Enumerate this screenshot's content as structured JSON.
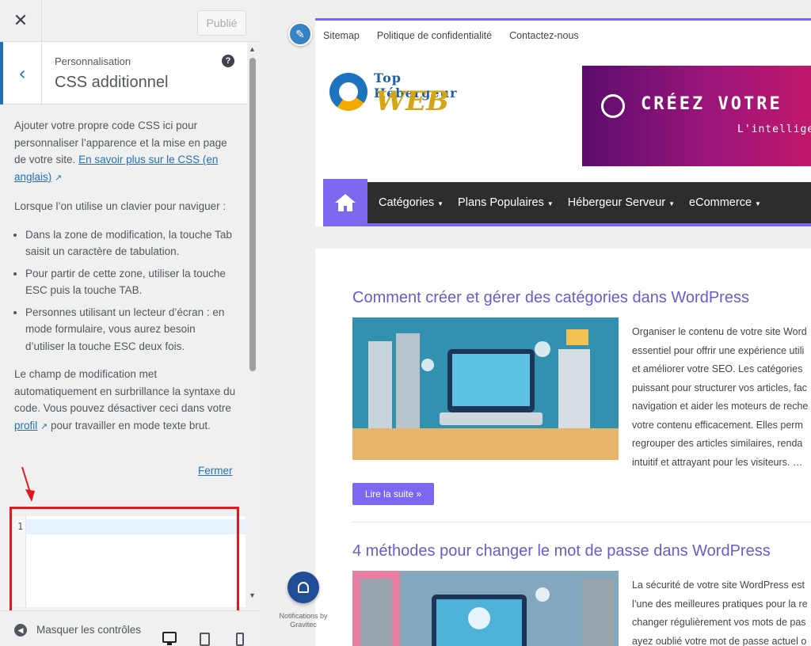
{
  "sidebar": {
    "close_glyph": "✕",
    "publish_label": "Publié",
    "section": {
      "breadcrumb": "Personnalisation",
      "title": "CSS additionnel",
      "help_glyph": "?"
    },
    "description": {
      "p1_text": "Ajouter votre propre code CSS ici pour personnaliser l’apparence et la mise en page de votre site.",
      "p1_link": "En savoir plus sur le CSS (en anglais)",
      "p2": "Lorsque l’on utilise un clavier pour naviguer :",
      "bullets": [
        "Dans la zone de modification, la touche Tab saisit un caractère de tabulation.",
        "Pour partir de cette zone, utiliser la touche ESC puis la touche TAB.",
        "Personnes utilisant un lecteur d’écran : en mode formulaire, vous aurez besoin d’utiliser la touche ESC deux fois."
      ],
      "p3_before": "Le champ de modification met automatiquement en surbrillance la syntaxe du code. Vous pouvez désactiver ceci dans votre",
      "p3_link": "profil",
      "p3_after": "pour travailler en mode texte brut."
    },
    "close_link": "Fermer",
    "editor": {
      "line_number": "1",
      "value": ""
    },
    "footer": {
      "hide_controls": "Masquer les contrôles"
    }
  },
  "preview": {
    "top_nav": [
      "Sitemap",
      "Politique de confidentialité",
      "Contactez-nous"
    ],
    "logo": {
      "line1": "Top Hébergeur",
      "line2": "WEB"
    },
    "banner": {
      "headline": "CRÉEZ VOTRE",
      "sub": "L'intelligen"
    },
    "main_nav": [
      "Catégories",
      "Plans Populaires",
      "Hébergeur Serveur",
      "eCommerce"
    ],
    "posts": [
      {
        "title": "Comment créer et gérer des catégories dans WordPress",
        "excerpt_lines": [
          "Organiser le contenu de votre site Word",
          "essentiel pour offrir une expérience utili",
          "et améliorer votre SEO. Les catégories",
          "puissant pour structurer vos articles, fac",
          "navigation et aider les moteurs de reche",
          "votre contenu efficacement. Elles perm",
          "regrouper des articles similaires, renda",
          "intuitif et attrayant pour les visiteurs. …"
        ],
        "read_more": "Lire la suite »"
      },
      {
        "title": "4 méthodes pour changer le mot de passe dans WordPress",
        "excerpt_lines": [
          "La sécurité de votre site WordPress est",
          "l’une des meilleures pratiques pour la re",
          "changer régulièrement vos mots de pas",
          "ayez oublié votre mot de passe actuel o"
        ]
      }
    ],
    "notification_label": "Notifications by Gravitec"
  },
  "colors": {
    "accent": "#7b68ee",
    "wp_blue": "#2271b1",
    "highlight_frame": "#e0191e"
  }
}
